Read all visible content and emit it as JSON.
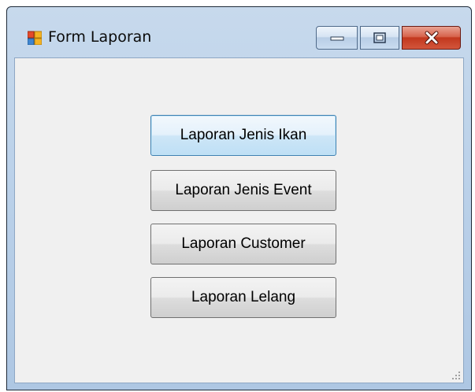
{
  "window": {
    "title": "Form Laporan",
    "icon": "windows-form-icon"
  },
  "caption_buttons": {
    "minimize_icon": "minimize-icon",
    "maximize_icon": "maximize-icon",
    "close_icon": "close-icon"
  },
  "buttons": [
    {
      "label": "Laporan Jenis Ikan",
      "focused": true
    },
    {
      "label": "Laporan Jenis Event",
      "focused": false
    },
    {
      "label": "Laporan Customer",
      "focused": false
    },
    {
      "label": "Laporan Lelang",
      "focused": false
    }
  ],
  "colors": {
    "title_frame": "#bcd2ea",
    "client_background": "#f0f0f0",
    "close_button": "#c2381e",
    "focus_border": "#3c7fb1"
  }
}
